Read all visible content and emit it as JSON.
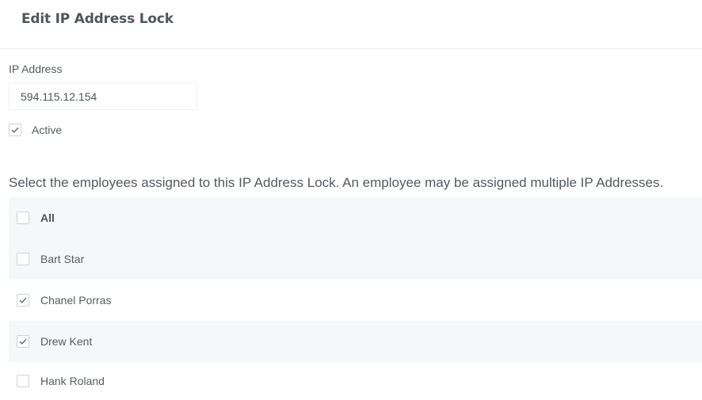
{
  "header": {
    "title": "Edit IP Address Lock"
  },
  "form": {
    "ip_label": "IP Address",
    "ip_value": "594.115.12.154",
    "active_label": "Active",
    "active_checked": true
  },
  "employees": {
    "instructions": "Select the employees assigned to this IP Address Lock. An employee may be assigned multiple IP Addresses.",
    "all_label": "All",
    "all_checked": false,
    "items": [
      {
        "name": "Bart Star",
        "checked": false
      },
      {
        "name": "Chanel Porras",
        "checked": true
      },
      {
        "name": "Drew Kent",
        "checked": true
      },
      {
        "name": "Hank Roland",
        "checked": false
      }
    ]
  },
  "icons": {
    "checkbox_check": "checkmark-icon"
  }
}
